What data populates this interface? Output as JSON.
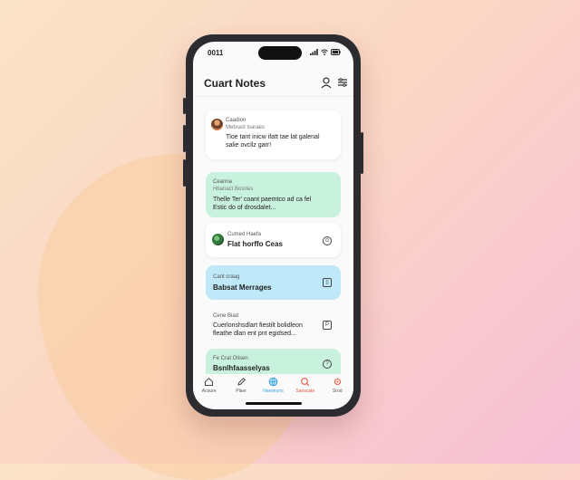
{
  "status_bar": {
    "time": "0011"
  },
  "header": {
    "title": "Cuart Notes"
  },
  "notes": [
    {
      "kind": "white",
      "meta1": "Caadion",
      "meta2": "Mebrast Isaraes",
      "body1": "Tloe  tant inicw ifatt tae lat galenal",
      "body2": "salie ovcllz garr!"
    },
    {
      "kind": "mint",
      "meta1": "Ceanna",
      "meta2": "Hbanact Bosrtes",
      "body1": "Thelle  Ter' coant paemtco ad  ca  fel",
      "body2": "Estic  do  of  drosdalet..."
    },
    {
      "kind": "white",
      "meta1": "Cumed Haefa",
      "title": "Flat horffo Ceas",
      "icon": "clock-icon"
    },
    {
      "kind": "sky",
      "meta1": "Cant craag",
      "title": "Babsat Merrages",
      "icon": "note-icon"
    },
    {
      "kind": "white",
      "meta1": "Cene Biad",
      "body1": "Cuerlonshsdlart fiestilt bolidleon",
      "body2": "fleathe  dlan  ent   pnt  egidsed...",
      "icon": "page-icon"
    },
    {
      "kind": "mint",
      "meta1": "Fe Crat Olisen",
      "title": "Bsnlhfaasselyas",
      "icon": "help-icon"
    }
  ],
  "tabs": [
    {
      "label": "Acoure",
      "color": "#444444"
    },
    {
      "label": "Plaer",
      "color": "#444444"
    },
    {
      "label": "Neeseuns",
      "color": "#3aa3e0"
    },
    {
      "label": "Sanscate",
      "color": "#e05a3a"
    },
    {
      "label": "Srod",
      "color": "#e05a3a"
    }
  ],
  "colors": {
    "mint": "#c9f2de",
    "sky": "#bfe8f8",
    "accent_blue": "#3aa3e0",
    "accent_red": "#e05a3a"
  }
}
